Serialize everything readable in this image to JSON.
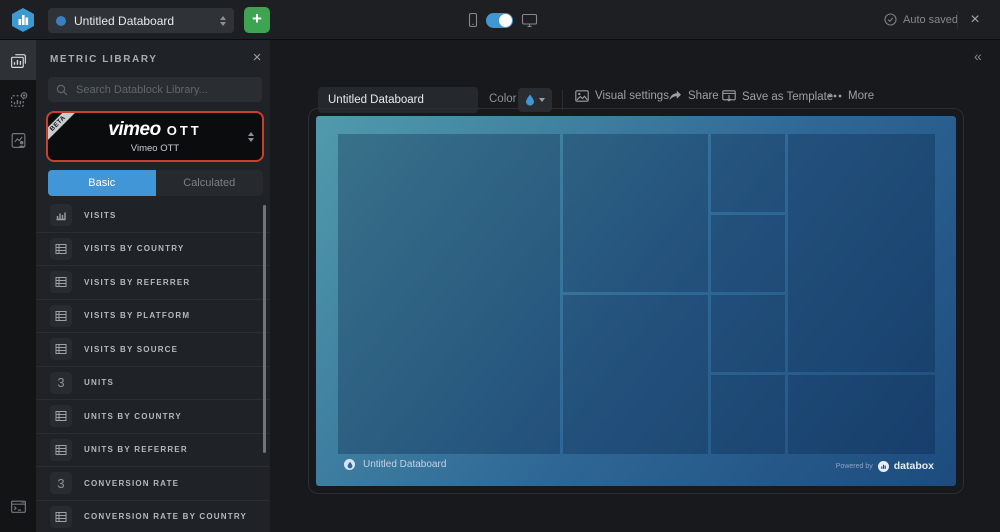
{
  "topbar": {
    "board_selector_value": "Untitled Databoard",
    "add_label": "+",
    "autosave_label": "Auto saved",
    "close_label": "×"
  },
  "panel": {
    "title": "METRIC LIBRARY",
    "close_label": "×",
    "search_placeholder": "Search Datablock Library...",
    "source": {
      "beta": "BETA",
      "logo_text": "vimeo",
      "logo_suffix": "OTT",
      "name": "Vimeo OTT"
    },
    "tabs": [
      {
        "label": "Basic",
        "active": true
      },
      {
        "label": "Calculated",
        "active": false
      }
    ],
    "number_glyph": "3",
    "metrics": [
      {
        "label": "VISITS",
        "icon": "bar-chart"
      },
      {
        "label": "VISITS BY COUNTRY",
        "icon": "table"
      },
      {
        "label": "VISITS BY REFERRER",
        "icon": "table"
      },
      {
        "label": "VISITS BY PLATFORM",
        "icon": "table"
      },
      {
        "label": "VISITS BY SOURCE",
        "icon": "table"
      },
      {
        "label": "UNITS",
        "icon": "number"
      },
      {
        "label": "UNITS BY COUNTRY",
        "icon": "table"
      },
      {
        "label": "UNITS BY REFERRER",
        "icon": "table"
      },
      {
        "label": "CONVERSION RATE",
        "icon": "number"
      },
      {
        "label": "CONVERSION RATE BY COUNTRY",
        "icon": "table"
      }
    ]
  },
  "toolbar": {
    "board_name_value": "Untitled Databoard",
    "color_label": "Color",
    "visual_settings_label": "Visual settings",
    "share_label": "Share",
    "save_template_label": "Save as Template",
    "more_label": "More",
    "collapse_glyph": "«"
  },
  "canvas": {
    "title": "Untitled Databoard",
    "powered_by": "Powered by",
    "brand": "databox"
  },
  "colors": {
    "accent_blue": "#3f97d3",
    "tab_active": "#4096d6",
    "add_green": "#3ea452",
    "source_highlight_border": "#c8402c",
    "canvas_gradient_start": "#519aab",
    "canvas_gradient_end": "#1d4b7d"
  }
}
